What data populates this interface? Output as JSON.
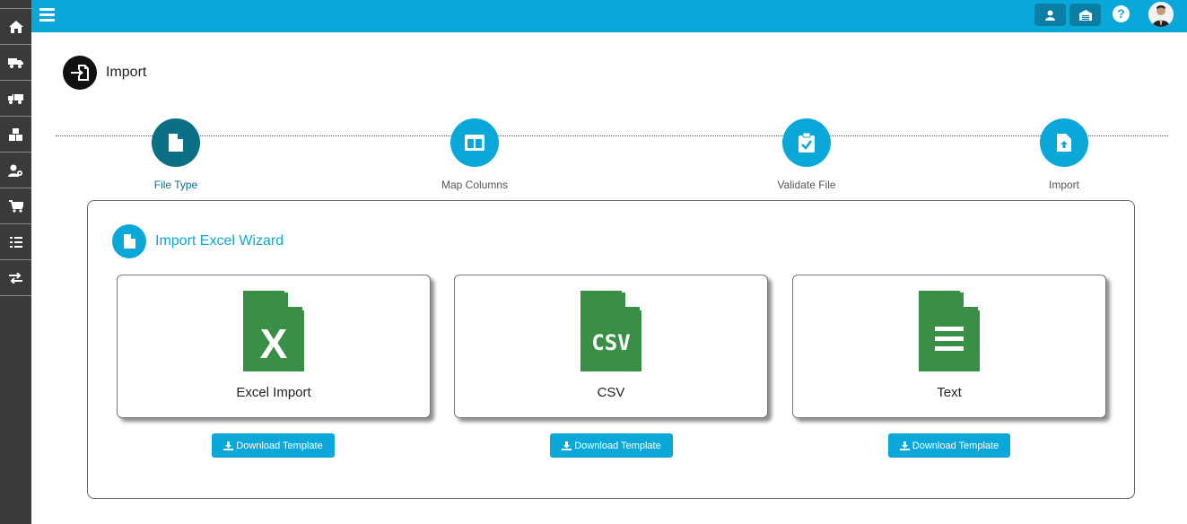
{
  "sidebar": {
    "items": [
      {
        "icon": "home-icon"
      },
      {
        "icon": "truck-icon"
      },
      {
        "icon": "delivery-truck-icon"
      },
      {
        "icon": "boxes-icon"
      },
      {
        "icon": "user-settings-icon"
      },
      {
        "icon": "cart-icon"
      },
      {
        "icon": "checklist-icon"
      },
      {
        "icon": "exchange-icon"
      }
    ]
  },
  "topbar": {
    "buttons": [
      {
        "icon": "user-icon"
      },
      {
        "icon": "warehouse-icon"
      }
    ],
    "help_label": "?"
  },
  "header": {
    "title": "Import"
  },
  "steps": [
    {
      "label": "File Type",
      "icon": "file-icon",
      "active": true
    },
    {
      "label": "Map Columns",
      "icon": "columns-icon",
      "active": false
    },
    {
      "label": "Validate File",
      "icon": "clipboard-check-icon",
      "active": false
    },
    {
      "label": "Import",
      "icon": "file-upload-icon",
      "active": false
    }
  ],
  "wizard": {
    "title": "Import Excel Wizard",
    "options": [
      {
        "label": "Excel Import",
        "icon": "excel-file-icon",
        "icon_text": "X",
        "download": "Download Template"
      },
      {
        "label": "CSV",
        "icon": "csv-file-icon",
        "icon_text": "CSV",
        "download": "Download Template"
      },
      {
        "label": "Text",
        "icon": "text-file-icon",
        "icon_text": "",
        "download": "Download Template"
      }
    ]
  },
  "colors": {
    "accent": "#0aa8d8",
    "active_step": "#0b6f86",
    "sidebar": "#3a3a3a",
    "file_icon_green": "#3a8f47"
  }
}
